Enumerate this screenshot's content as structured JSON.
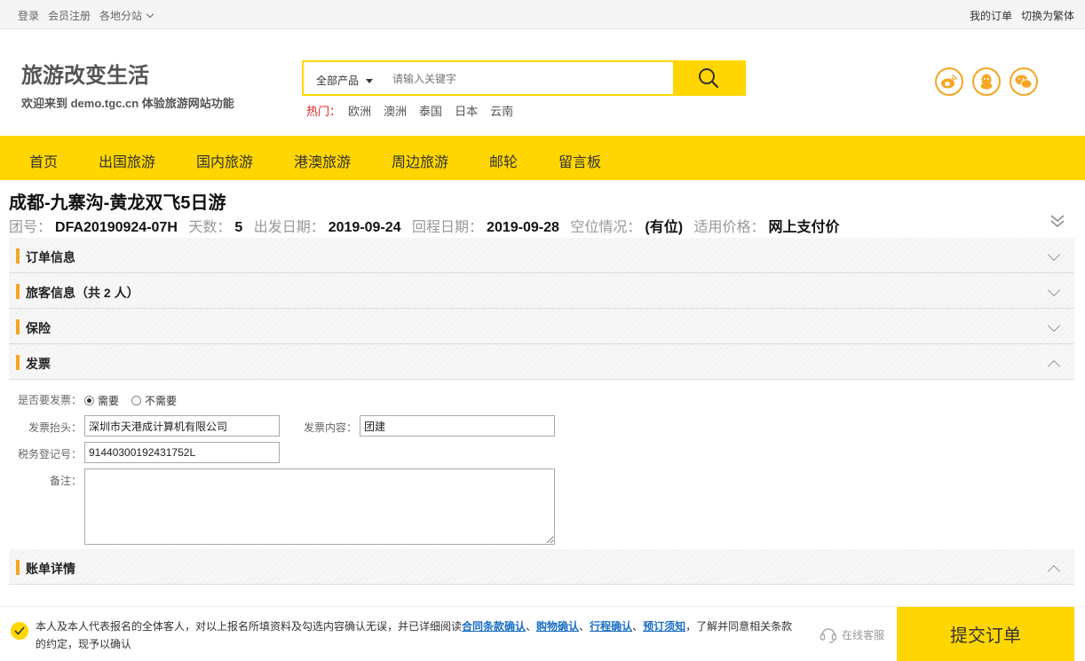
{
  "topbar": {
    "login": "登录",
    "register": "会员注册",
    "branches": "各地分站",
    "my_orders": "我的订单",
    "switch_lang": "切换为繁体"
  },
  "header": {
    "brand_title": "旅游改变生活",
    "brand_sub": "欢迎来到 demo.tgc.cn 体验旅游网站功能"
  },
  "search": {
    "category": "全部产品",
    "placeholder": "请输入关键字",
    "hot_label": "热门：",
    "hot_items": [
      "欧洲",
      "澳洲",
      "泰国",
      "日本",
      "云南"
    ]
  },
  "nav": {
    "items": [
      "首页",
      "出国旅游",
      "国内旅游",
      "港澳旅游",
      "周边旅游",
      "邮轮",
      "留言板"
    ]
  },
  "tour": {
    "title": "成都-九寨沟-黄龙双飞5日游",
    "group_label": "团号：",
    "group_no": "DFA20190924-07H",
    "days_label": "天数：",
    "days": "5",
    "depart_label": "出发日期：",
    "depart": "2019-09-24",
    "return_label": "回程日期：",
    "return": "2019-09-28",
    "seats_label": "空位情况：",
    "seats": "(有位)",
    "price_label": "适用价格：",
    "price": "网上支付价"
  },
  "sections": {
    "order": "订单信息",
    "travelers": "旅客信息（共 2 人）",
    "insurance": "保险",
    "invoice": "发票",
    "bill": "账单详情"
  },
  "invoice": {
    "need_label": "是否要发票：",
    "opt_yes": "需要",
    "opt_no": "不需要",
    "selected": "需要",
    "header_label": "发票抬头：",
    "header_value": "深圳市天港成计算机有限公司",
    "content_label": "发票内容：",
    "content_value": "团建",
    "tax_label": "税务登记号：",
    "tax_value": "91440300192431752L",
    "remark_label": "备注：",
    "remark_value": ""
  },
  "footer": {
    "agree_prefix": "本人及本人代表报名的全体客人，对以上报名所填资料及勾选内容确认无误，并已详细阅读",
    "link_contract": "合同条款确认",
    "sep1": "、",
    "link_shopping": "购物确认",
    "sep2": "、",
    "link_itinerary": "行程确认",
    "sep3": "、",
    "link_notice": "预订须知",
    "agree_suffix": "，了解并同意相关条款的约定，现予以确认",
    "service": "在线客服",
    "submit": "提交订单"
  },
  "colors": {
    "accent": "#ffd600",
    "section_bar": "#f5a623",
    "link": "#1a6fc4",
    "hot": "#e02222"
  }
}
